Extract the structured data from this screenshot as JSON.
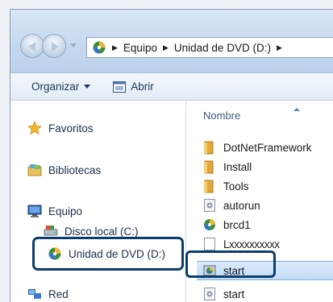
{
  "address_bar": {
    "breadcrumbs": [
      "Equipo",
      "Unidad de DVD (D:)"
    ],
    "icon": "dvd-drive-icon"
  },
  "toolbar": {
    "organize_label": "Organizar",
    "open_label": "Abrir",
    "open_icon": "open-window-icon"
  },
  "nav_pane": {
    "items": [
      {
        "label": "Favoritos",
        "icon": "star-icon"
      },
      {
        "label": "Bibliotecas",
        "icon": "library-icon"
      },
      {
        "label": "Equipo",
        "icon": "computer-icon"
      },
      {
        "label": "Disco local (C:)",
        "icon": "hard-disk-icon"
      },
      {
        "label": "Unidad de DVD (D:)",
        "icon": "dvd-drive-icon"
      },
      {
        "label": "Red",
        "icon": "network-icon"
      }
    ]
  },
  "file_pane": {
    "column_header": "Nombre",
    "items": [
      {
        "name": "DotNetFramework",
        "icon": "folder-icon"
      },
      {
        "name": "Install",
        "icon": "folder-icon"
      },
      {
        "name": "Tools",
        "icon": "folder-icon"
      },
      {
        "name": "autorun",
        "icon": "settings-file-icon"
      },
      {
        "name": "brcd1",
        "icon": "installer-icon"
      },
      {
        "name": "Lxxxxxxxxxx",
        "icon": "blank-file-icon"
      },
      {
        "name": "start",
        "icon": "setup-app-icon",
        "selected": true
      },
      {
        "name": "start",
        "icon": "settings-file-icon"
      }
    ]
  },
  "colors": {
    "highlight_border": "#0b3d6e",
    "selection": "#c3dcf7"
  }
}
